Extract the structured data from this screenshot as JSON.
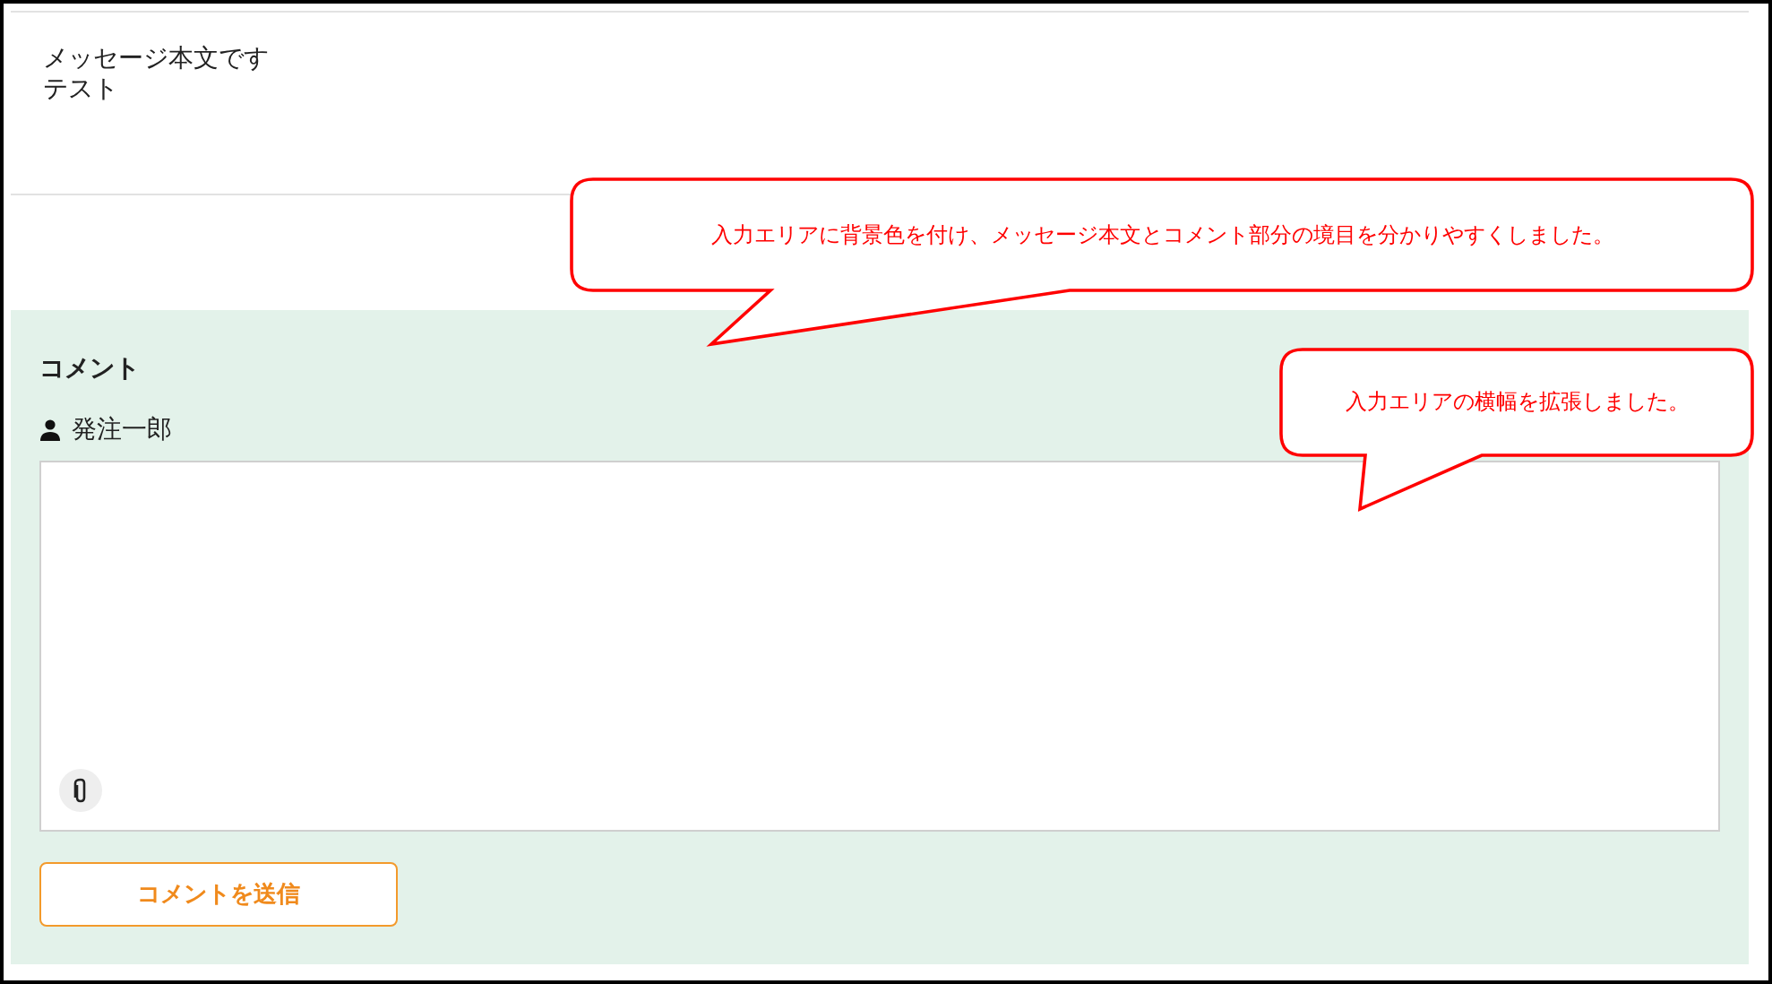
{
  "message": {
    "lines": [
      "メッセージ本文です",
      "テスト"
    ]
  },
  "comment_section": {
    "title": "コメント",
    "user": "発注一郎",
    "submit_button": "コメントを送信"
  },
  "annotations": [
    {
      "text": "入力エリアに背景色を付け、メッセージ本文とコメント部分の境目を分かりやすくしました。"
    },
    {
      "text": "入力エリアの横幅を拡張しました。"
    }
  ]
}
